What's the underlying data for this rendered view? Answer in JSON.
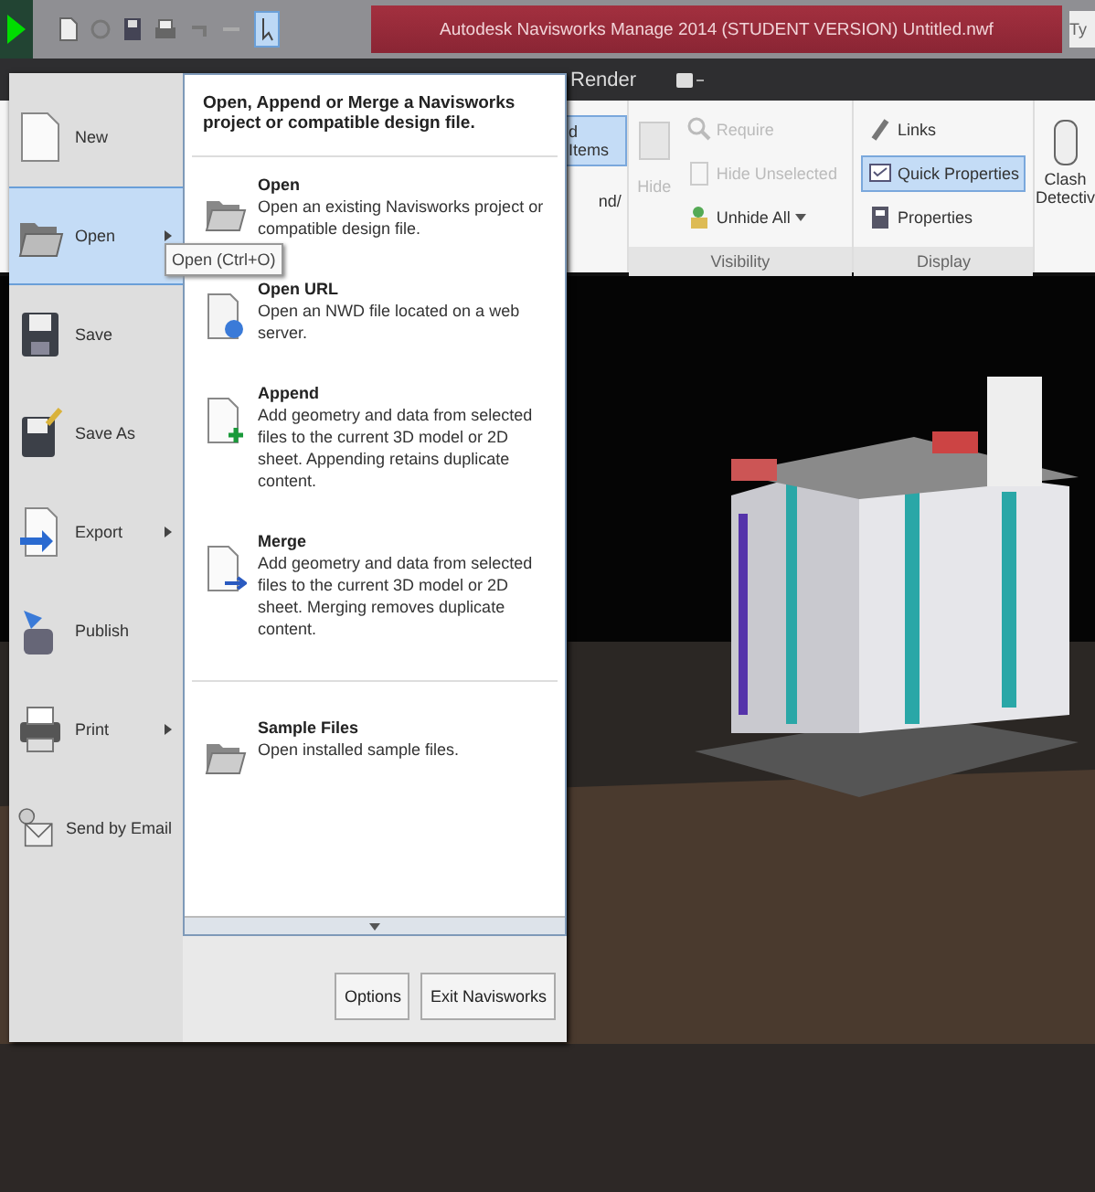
{
  "title_bar": {
    "title": "Autodesk Navisworks Manage 2014 (STUDENT VERSION)    Untitled.nwf",
    "search_partial": "Ty"
  },
  "ribbon_tabs": [
    {
      "label": "Render"
    }
  ],
  "ribbon": {
    "partial_items": [
      {
        "label": "d Items",
        "selected": true
      },
      {
        "label": "nd/",
        "selected": false
      }
    ],
    "panels": [
      {
        "label": "Visibility",
        "big": {
          "label": "Hide",
          "disabled": true
        },
        "items": [
          {
            "label": "Require",
            "kind": "search",
            "disabled": true,
            "selected": false,
            "dropdown": false
          },
          {
            "label": "Hide Unselected",
            "kind": "hide",
            "disabled": true,
            "selected": false,
            "dropdown": false
          },
          {
            "label": "Unhide All",
            "kind": "unhide",
            "disabled": false,
            "selected": false,
            "dropdown": true
          }
        ]
      },
      {
        "label": "Display",
        "items": [
          {
            "label": "Links",
            "kind": "link",
            "disabled": false,
            "selected": false,
            "dropdown": false
          },
          {
            "label": "Quick Properties",
            "kind": "quick",
            "disabled": false,
            "selected": true,
            "dropdown": false
          },
          {
            "label": "Properties",
            "kind": "props",
            "disabled": false,
            "selected": false,
            "dropdown": false
          }
        ]
      }
    ],
    "cut_button": "Clash Detectiv"
  },
  "menu": {
    "commands": [
      {
        "label": "New",
        "kind": "new",
        "selected": false,
        "submenu": false
      },
      {
        "label": "Open",
        "kind": "open",
        "selected": true,
        "submenu": true
      },
      {
        "label": "Save",
        "kind": "save",
        "selected": false,
        "submenu": false
      },
      {
        "label": "Save As",
        "kind": "saveas",
        "selected": false,
        "submenu": false
      },
      {
        "label": "Export",
        "kind": "export",
        "selected": false,
        "submenu": true
      },
      {
        "label": "Publish",
        "kind": "publish",
        "selected": false,
        "submenu": false
      },
      {
        "label": "Print",
        "kind": "print",
        "selected": false,
        "submenu": true
      },
      {
        "label": "Send by Email",
        "kind": "email",
        "selected": false,
        "submenu": false
      }
    ],
    "tooltip": "Open (Ctrl+O)",
    "panel": {
      "heading": "Open, Append or Merge a Navisworks project or compatible design file.",
      "entries": [
        {
          "title": "Open",
          "description": "Open an existing Navisworks project or compatible design file.",
          "kind": "folder"
        },
        {
          "title": "Open URL",
          "description": "Open an NWD file located on a web server.",
          "kind": "url"
        },
        {
          "title": "Append",
          "description": "Add geometry and data from selected files to the current 3D model or 2D sheet. Appending retains duplicate content.",
          "kind": "append"
        },
        {
          "title": "Merge",
          "description": "Add geometry and data from selected files to the current 3D model or 2D sheet. Merging removes duplicate content.",
          "kind": "merge"
        },
        {
          "title": "Sample Files",
          "description": "Open installed sample files.",
          "kind": "folder"
        }
      ]
    },
    "buttons": [
      "Options",
      "Exit Navisworks"
    ]
  }
}
